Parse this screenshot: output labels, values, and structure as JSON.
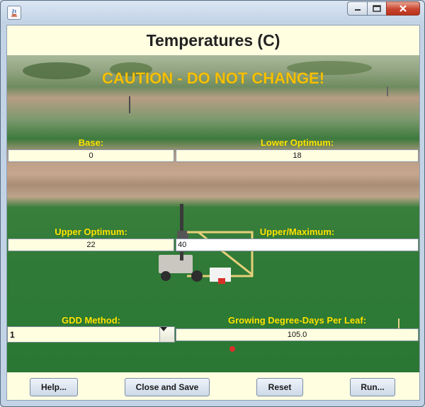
{
  "window": {
    "heading": "Temperatures (C)",
    "caution": "CAUTION - DO NOT CHANGE!"
  },
  "fields": {
    "base": {
      "label": "Base:",
      "value": "0"
    },
    "lower_optimum": {
      "label": "Lower Optimum:",
      "value": "18"
    },
    "upper_optimum": {
      "label": "Upper Optimum:",
      "value": "22"
    },
    "upper_maximum": {
      "label": "Upper/Maximum:",
      "value": "40"
    },
    "gdd_method": {
      "label": "GDD Method:",
      "value": "1"
    },
    "gdd_per_leaf": {
      "label": "Growing Degree-Days Per Leaf:",
      "value": "105.0"
    }
  },
  "buttons": {
    "help": "Help...",
    "close_save": "Close and Save",
    "reset": "Reset",
    "run": "Run..."
  },
  "colors": {
    "label_yellow": "#ffe600",
    "caution_orange": "#f7c000",
    "panel_bg": "#fffee1"
  }
}
